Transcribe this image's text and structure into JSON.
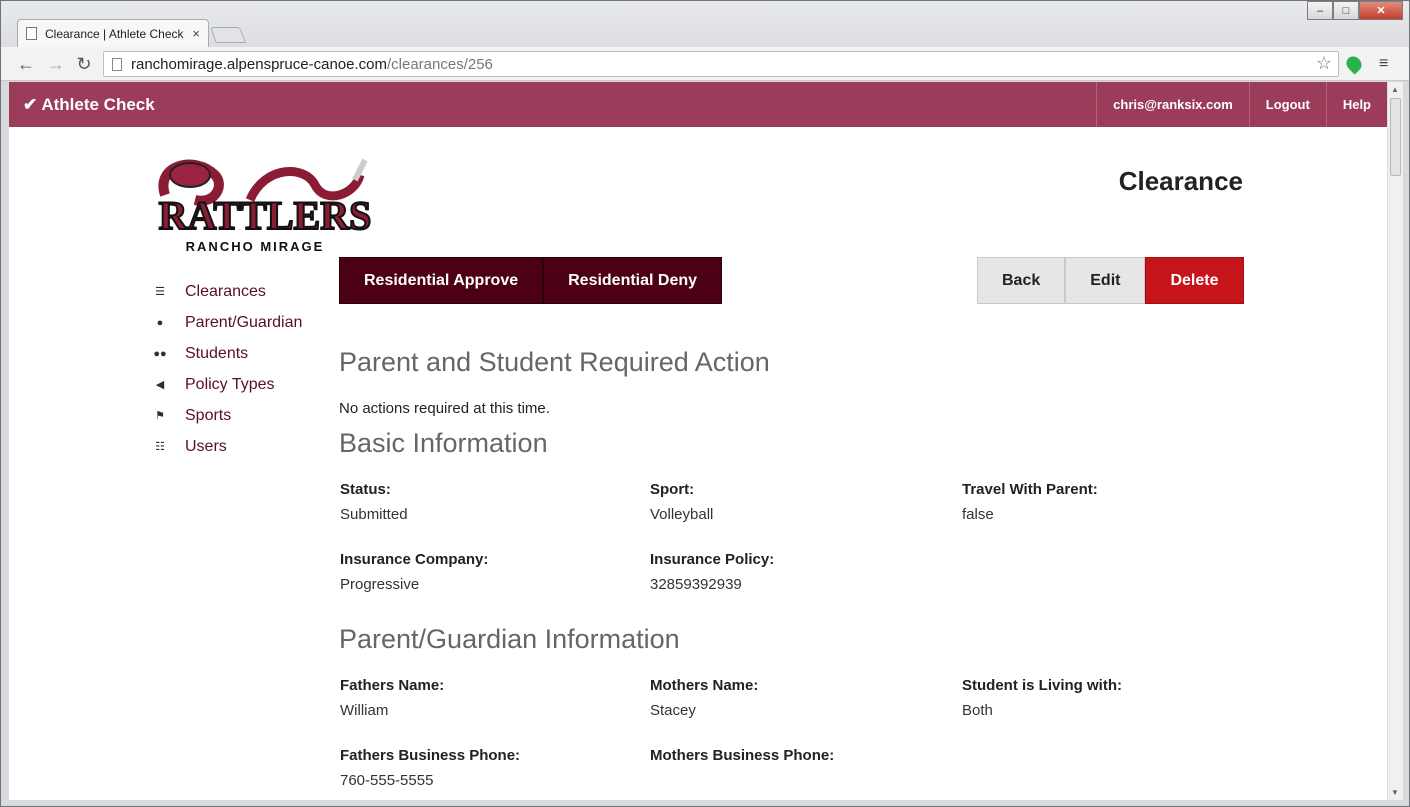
{
  "browser": {
    "tab_title": "Clearance | Athlete Check",
    "tab_close": "×",
    "url_host": "ranchomirage.alpenspruce-canoe.com",
    "url_path": "/clearances/256",
    "window_minimize": "–",
    "window_maximize": "□",
    "window_close": "✕"
  },
  "navbar": {
    "brand": "✔ Athlete Check",
    "user": "chris@ranksix.com",
    "logout": "Logout",
    "help": "Help",
    "background_color": "#9b3d5a"
  },
  "logo": {
    "word": "RATTLERS",
    "subtitle": "RANCHO MIRAGE"
  },
  "page_title": "Clearance",
  "sidebar": {
    "items": [
      {
        "label": "Clearances",
        "icon": "list-icon",
        "glyph": "☰"
      },
      {
        "label": "Parent/Guardian",
        "icon": "user-icon",
        "glyph": "●"
      },
      {
        "label": "Students",
        "icon": "group-icon",
        "glyph": "●●"
      },
      {
        "label": "Policy Types",
        "icon": "bullhorn-icon",
        "glyph": "◀"
      },
      {
        "label": "Sports",
        "icon": "flag-icon",
        "glyph": "⚑"
      },
      {
        "label": "Users",
        "icon": "users-list-icon",
        "glyph": "☷"
      }
    ]
  },
  "actions": {
    "approve": "Residential Approve",
    "deny": "Residential Deny",
    "back": "Back",
    "edit": "Edit",
    "delete": "Delete"
  },
  "required_action": {
    "heading": "Parent and Student Required Action",
    "text": "No actions required at this time."
  },
  "basic_info": {
    "heading": "Basic Information",
    "status": {
      "label": "Status:",
      "value": "Submitted"
    },
    "sport": {
      "label": "Sport:",
      "value": "Volleyball"
    },
    "travel": {
      "label": "Travel With Parent:",
      "value": "false"
    },
    "insurance_company": {
      "label": "Insurance Company:",
      "value": "Progressive"
    },
    "insurance_policy": {
      "label": "Insurance Policy:",
      "value": "32859392939"
    }
  },
  "guardian_info": {
    "heading": "Parent/Guardian Information",
    "fathers_name": {
      "label": "Fathers Name:",
      "value": "William"
    },
    "mothers_name": {
      "label": "Mothers Name:",
      "value": "Stacey"
    },
    "living_with": {
      "label": "Student is Living with:",
      "value": "Both"
    },
    "fathers_phone": {
      "label": "Fathers Business Phone:",
      "value": "760-555-5555"
    },
    "mothers_phone": {
      "label": "Mothers Business Phone:",
      "value": ""
    }
  }
}
